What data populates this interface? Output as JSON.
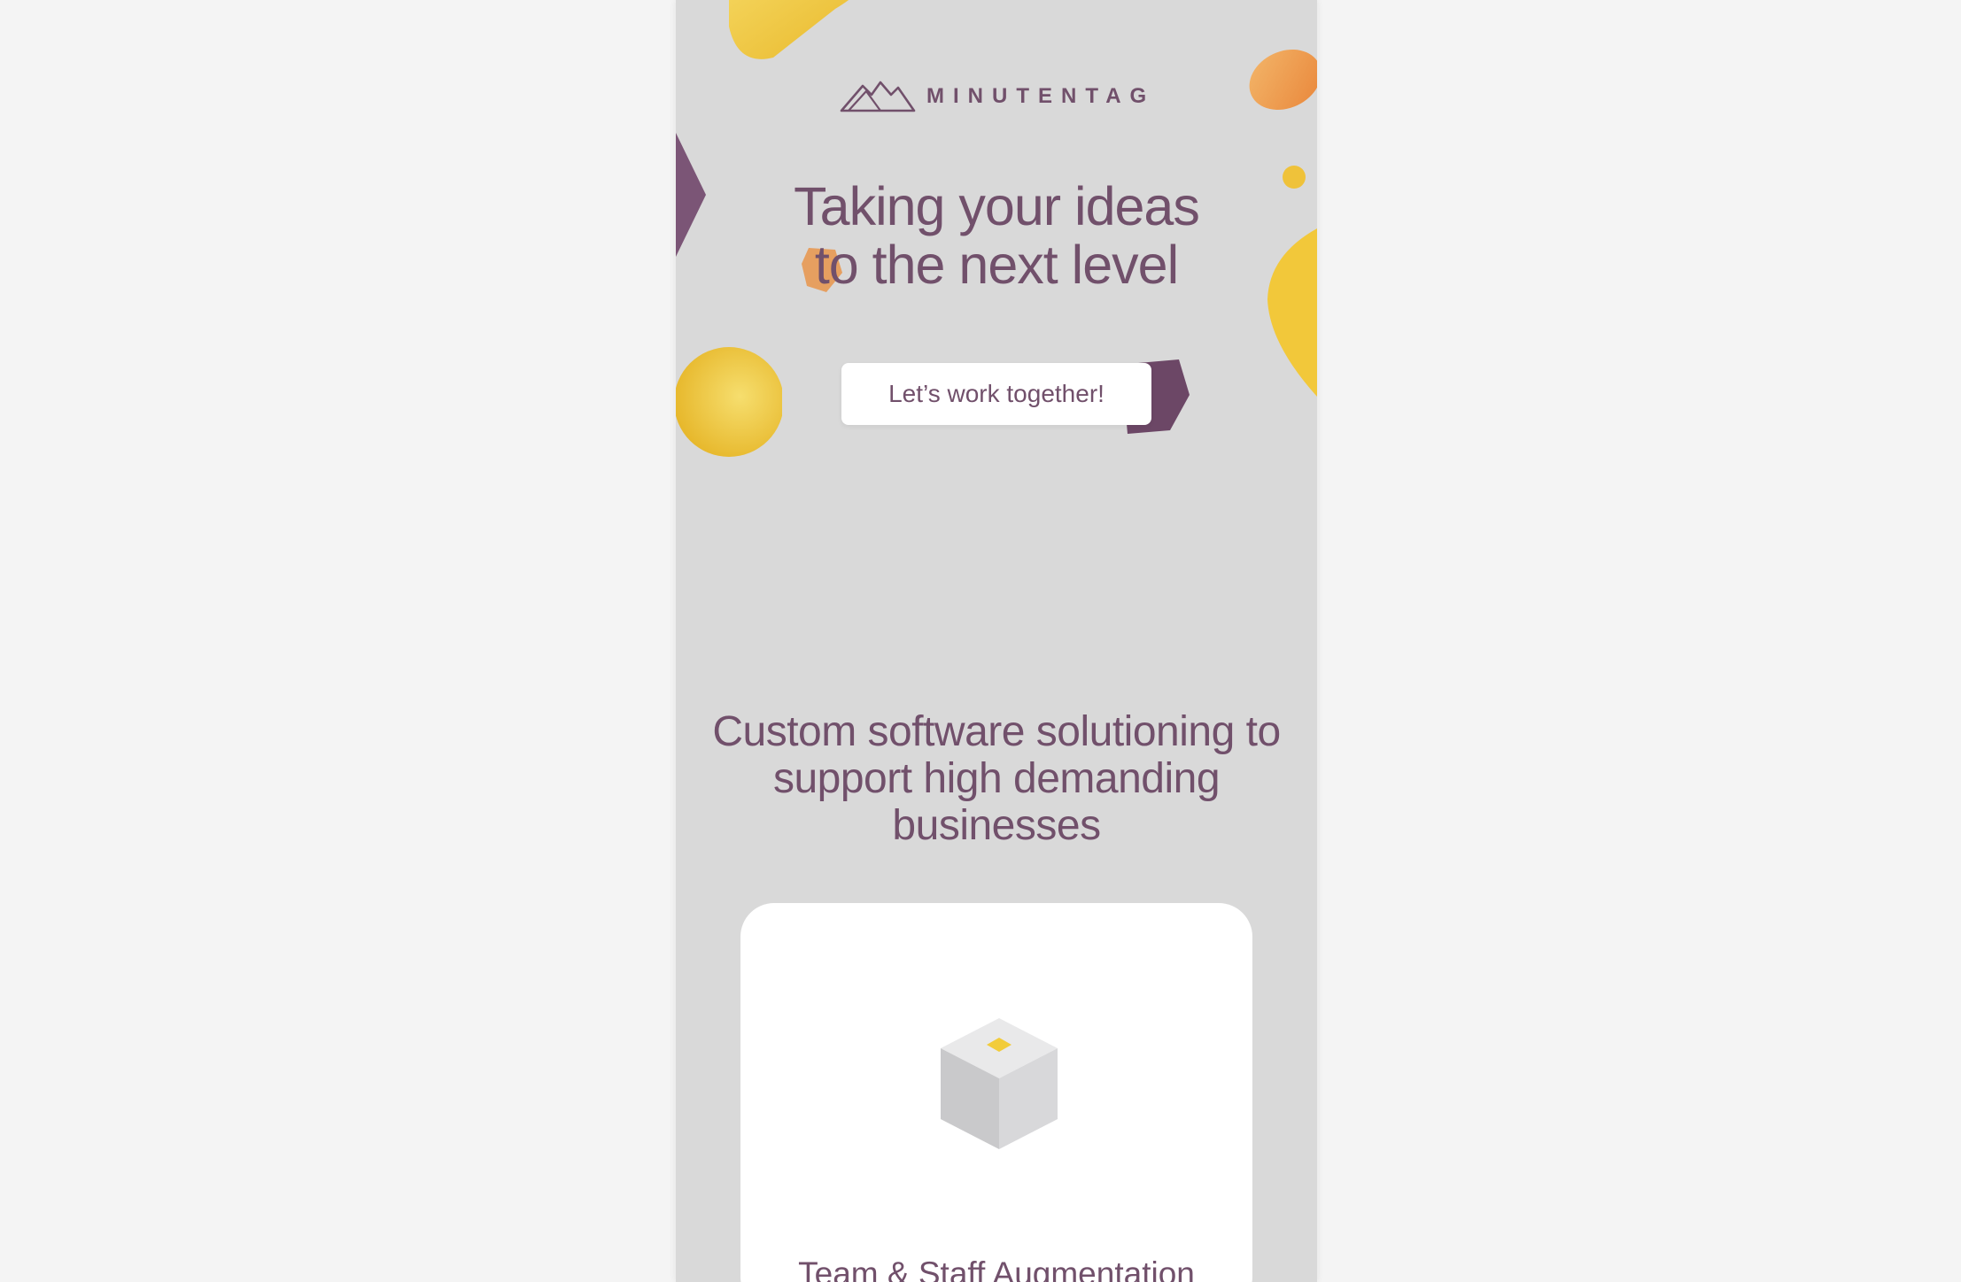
{
  "brand": {
    "name": "MINUTENTAG",
    "logo_icon": "mountain-icon",
    "accent": "#71506b"
  },
  "hero": {
    "title_line1": "Taking your ideas",
    "title_line2": "to the next level",
    "cta_label": "Let’s work together!"
  },
  "services": {
    "heading": "Custom software solutioning to support high demanding businesses",
    "cards": [
      {
        "title": "Team & Staff Augmentation",
        "icon": "cube-icon"
      }
    ]
  },
  "colors": {
    "background": "#f4f4f4",
    "panel": "#d9d9d9",
    "text": "#71506b",
    "yellow": "#f2c83a",
    "orange": "#f0a050",
    "purple": "#6e4a68"
  }
}
